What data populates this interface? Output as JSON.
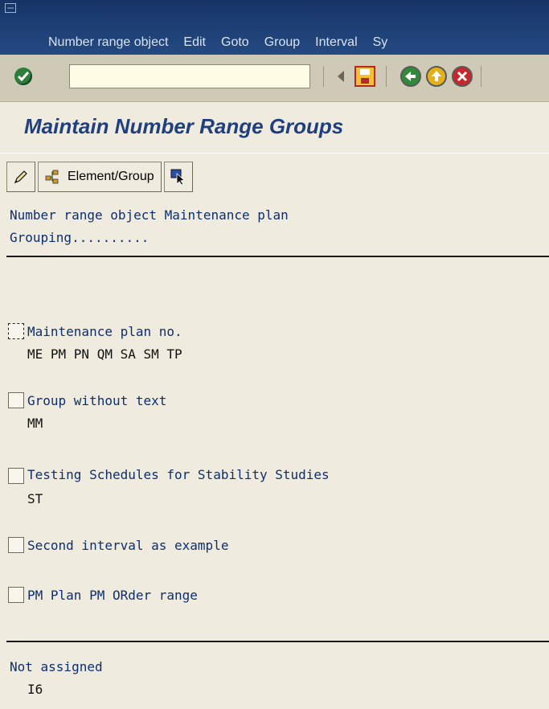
{
  "menu": {
    "items": [
      "Number range object",
      "Edit",
      "Goto",
      "Group",
      "Interval",
      "Sy"
    ]
  },
  "title": "Maintain Number Range Groups",
  "app_toolbar": {
    "element_group_label": "Element/Group"
  },
  "header": {
    "line1": "Number range object Maintenance plan",
    "line2": "Grouping.........."
  },
  "groups": [
    {
      "name": "Maintenance plan no.",
      "elements": "ME PM PN QM SA SM TP"
    },
    {
      "name": "Group without text",
      "elements": "MM"
    },
    {
      "name": "Testing Schedules for Stability Studies",
      "elements": "ST"
    },
    {
      "name": "Second interval as example",
      "elements": ""
    },
    {
      "name": "PM Plan PM ORder range",
      "elements": ""
    }
  ],
  "not_assigned": {
    "label": "Not assigned",
    "elements": "I6"
  },
  "colors": {
    "menubar": "#1b3b6f",
    "title": "#1f3f7f",
    "background": "#efecdf",
    "toolbar": "#cfcab5"
  },
  "icons": [
    "system-menu-icon",
    "enter-checkmark-icon",
    "back-triangle-icon",
    "save-icon",
    "back-green-icon",
    "exit-yellow-icon",
    "cancel-red-icon",
    "pencil-icon",
    "element-group-icon",
    "select-cursor-icon"
  ]
}
